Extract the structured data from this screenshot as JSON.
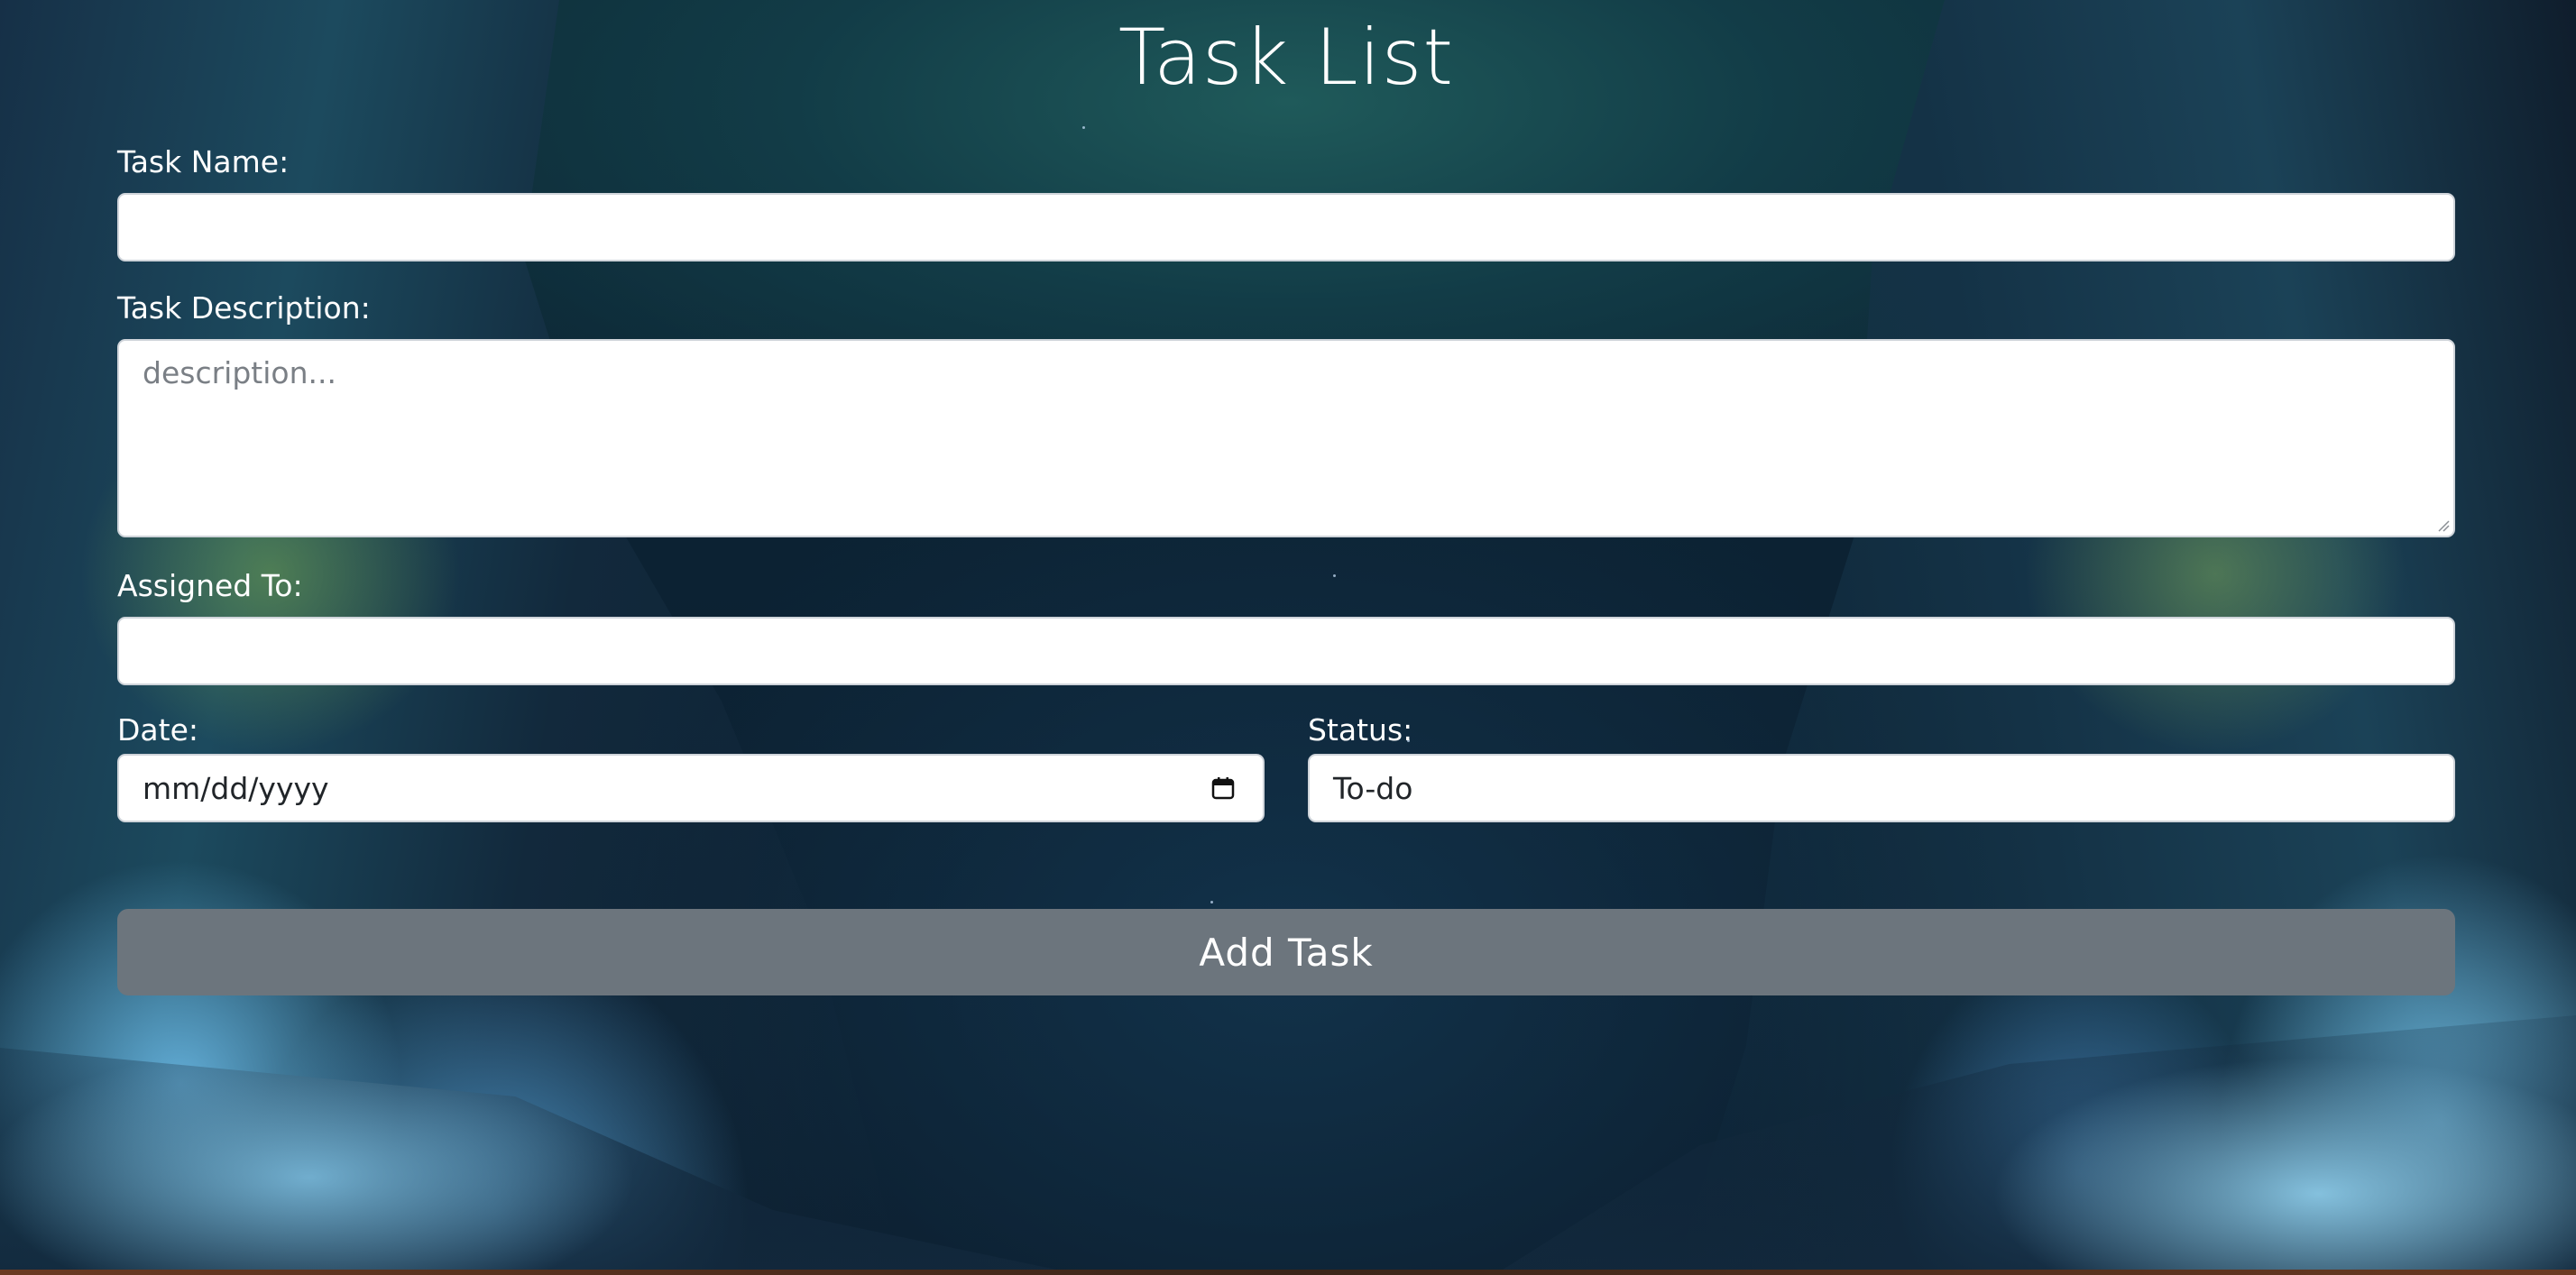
{
  "page": {
    "title": "Task List"
  },
  "form": {
    "task_name": {
      "label": "Task Name:",
      "value": "",
      "placeholder": ""
    },
    "task_description": {
      "label": "Task Description:",
      "value": "",
      "placeholder": "description..."
    },
    "assigned_to": {
      "label": "Assigned To:",
      "value": "",
      "placeholder": ""
    },
    "date": {
      "label": "Date:",
      "display": "mm/dd/yyyy",
      "icon": "calendar-icon"
    },
    "status": {
      "label": "Status:",
      "value": "To-do"
    },
    "submit_label": "Add Task"
  },
  "colors": {
    "button_bg": "#6c757d",
    "text": "#ffffff",
    "field_bg": "#ffffff"
  }
}
